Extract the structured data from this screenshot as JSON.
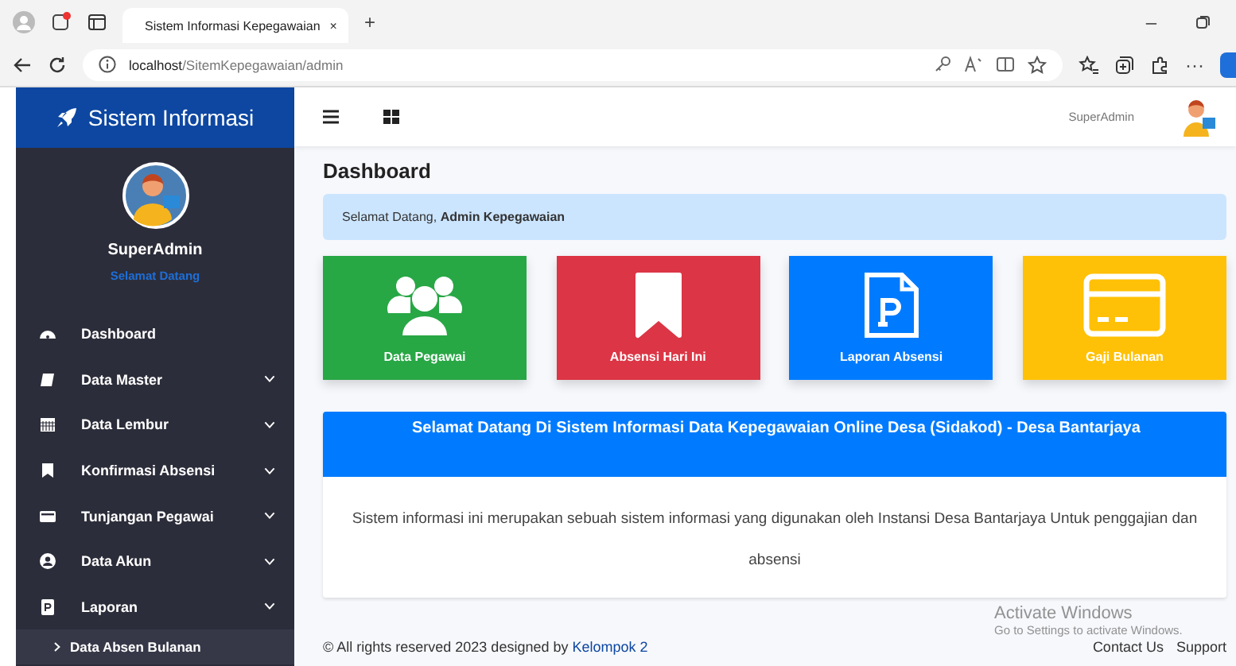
{
  "browser": {
    "tab_title": "Sistem Informasi Kepegawaian",
    "tab_close": "×",
    "new_tab": "+",
    "minimize": "–",
    "url_host": "localhost",
    "url_path": "/SitemKepegawaian/admin",
    "more": "···"
  },
  "sidebar": {
    "brand": "Sistem Informasi",
    "user_name": "SuperAdmin",
    "user_status": "Selamat Datang",
    "items": [
      {
        "label": "Dashboard",
        "has_submenu": false
      },
      {
        "label": "Data Master",
        "has_submenu": true
      },
      {
        "label": "Data Lembur",
        "has_submenu": true
      },
      {
        "label": "Konfirmasi Absensi",
        "has_submenu": true
      },
      {
        "label": "Tunjangan Pegawai",
        "has_submenu": true
      },
      {
        "label": "Data Akun",
        "has_submenu": true
      },
      {
        "label": "Laporan",
        "has_submenu": true,
        "children": [
          {
            "label": "Data Absen Bulanan"
          }
        ]
      }
    ]
  },
  "topbar": {
    "user_name": "SuperAdmin"
  },
  "content": {
    "title": "Dashboard",
    "alert": "Selamat Datang, **Admin Kepegawaian**",
    "cards": [
      {
        "label": "Data Pegawai",
        "color": "#28a745"
      },
      {
        "label": "Absensi Hari Ini",
        "color": "#dc3545"
      },
      {
        "label": "Laporan Absensi",
        "color": "#007bff"
      },
      {
        "label": "Gaji Bulanan",
        "color": "#ffc107"
      }
    ],
    "panel": {
      "heading": "Selamat Datang Di Sistem Informasi Data Kepegawaian Online Desa (Sidakod) - Desa Bantarjaya",
      "body": "Sistem informasi ini merupakan sebuah sistem informasi yang digunakan oleh Instansi Desa Bantarjaya Untuk penggajian dan absensi"
    }
  },
  "footer": {
    "text": "© All rights reserved 2023 designed by",
    "link": "Kelompok 2",
    "links": [
      "Contact Us",
      "Support"
    ]
  },
  "os_notice": {
    "title": "Activate Windows",
    "subtitle": "Go to Settings to activate Windows."
  }
}
